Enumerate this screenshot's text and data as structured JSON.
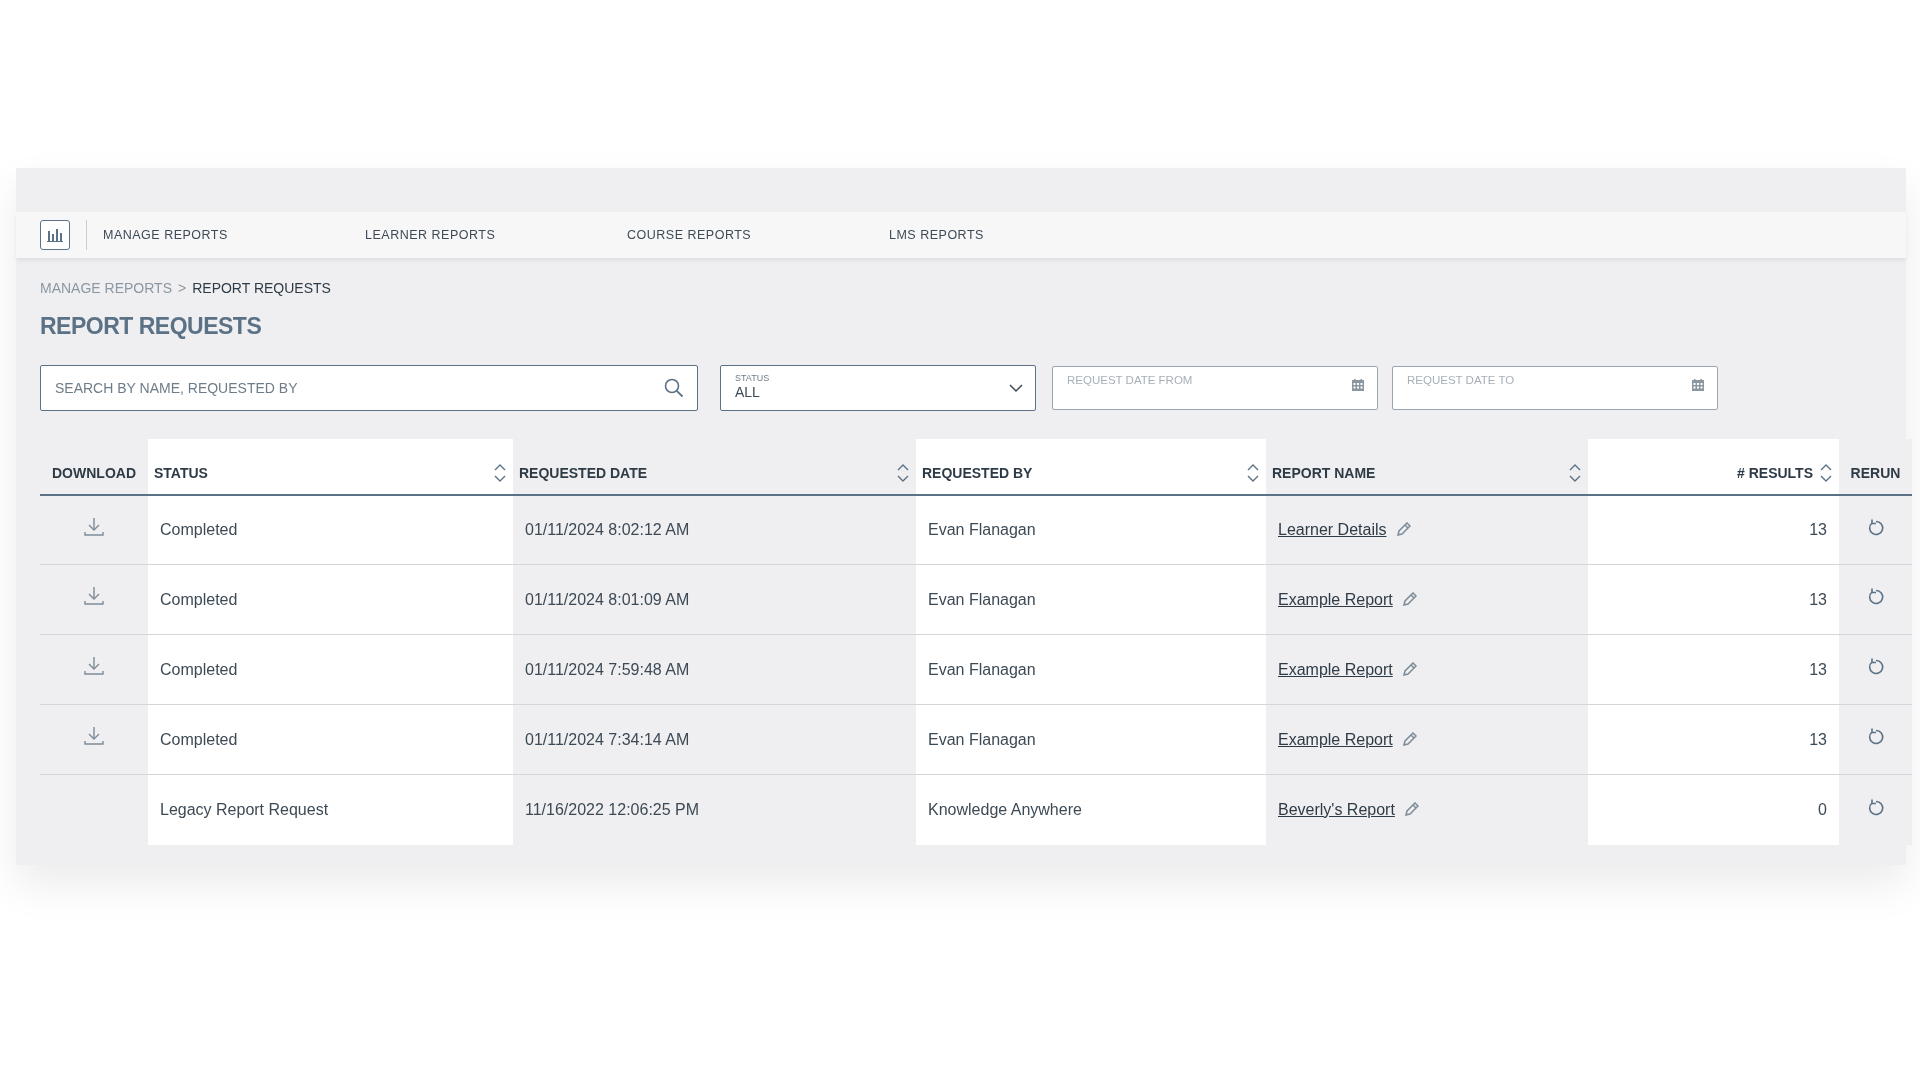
{
  "nav": {
    "items": [
      {
        "label": "MANAGE REPORTS"
      },
      {
        "label": "LEARNER REPORTS"
      },
      {
        "label": "COURSE REPORTS"
      },
      {
        "label": "LMS REPORTS"
      }
    ]
  },
  "breadcrumb": {
    "separator": ">",
    "items": [
      {
        "label": "MANAGE REPORTS",
        "current": false
      },
      {
        "label": "REPORT REQUESTS",
        "current": true
      }
    ]
  },
  "title": "REPORT REQUESTS",
  "filters": {
    "search": {
      "placeholder": "SEARCH BY NAME, REQUESTED BY"
    },
    "status": {
      "label": "STATUS",
      "value": "ALL"
    },
    "date_from": {
      "placeholder": "REQUEST DATE FROM"
    },
    "date_to": {
      "placeholder": "REQUEST DATE TO"
    }
  },
  "table": {
    "columns": [
      {
        "label": "DOWNLOAD",
        "sortable": false
      },
      {
        "label": "STATUS",
        "sortable": true
      },
      {
        "label": "REQUESTED DATE",
        "sortable": true
      },
      {
        "label": "REQUESTED BY",
        "sortable": true
      },
      {
        "label": "REPORT NAME",
        "sortable": true
      },
      {
        "label": "# RESULTS",
        "sortable": true
      },
      {
        "label": "RERUN",
        "sortable": false
      }
    ],
    "rows": [
      {
        "downloadable": true,
        "status": "Completed",
        "requested_date": "01/11/2024 8:02:12 AM",
        "requested_by": "Evan Flanagan",
        "report_name": "Learner Details",
        "results": "13"
      },
      {
        "downloadable": true,
        "status": "Completed",
        "requested_date": "01/11/2024 8:01:09 AM",
        "requested_by": "Evan Flanagan",
        "report_name": "Example Report",
        "results": "13"
      },
      {
        "downloadable": true,
        "status": "Completed",
        "requested_date": "01/11/2024 7:59:48 AM",
        "requested_by": "Evan Flanagan",
        "report_name": "Example Report",
        "results": "13"
      },
      {
        "downloadable": true,
        "status": "Completed",
        "requested_date": "01/11/2024 7:34:14 AM",
        "requested_by": "Evan Flanagan",
        "report_name": "Example Report",
        "results": "13"
      },
      {
        "downloadable": false,
        "status": "Legacy Report Request",
        "requested_date": "11/16/2022 12:06:25 PM",
        "requested_by": "Knowledge Anywhere",
        "report_name": "Beverly's Report",
        "results": "0"
      }
    ]
  }
}
